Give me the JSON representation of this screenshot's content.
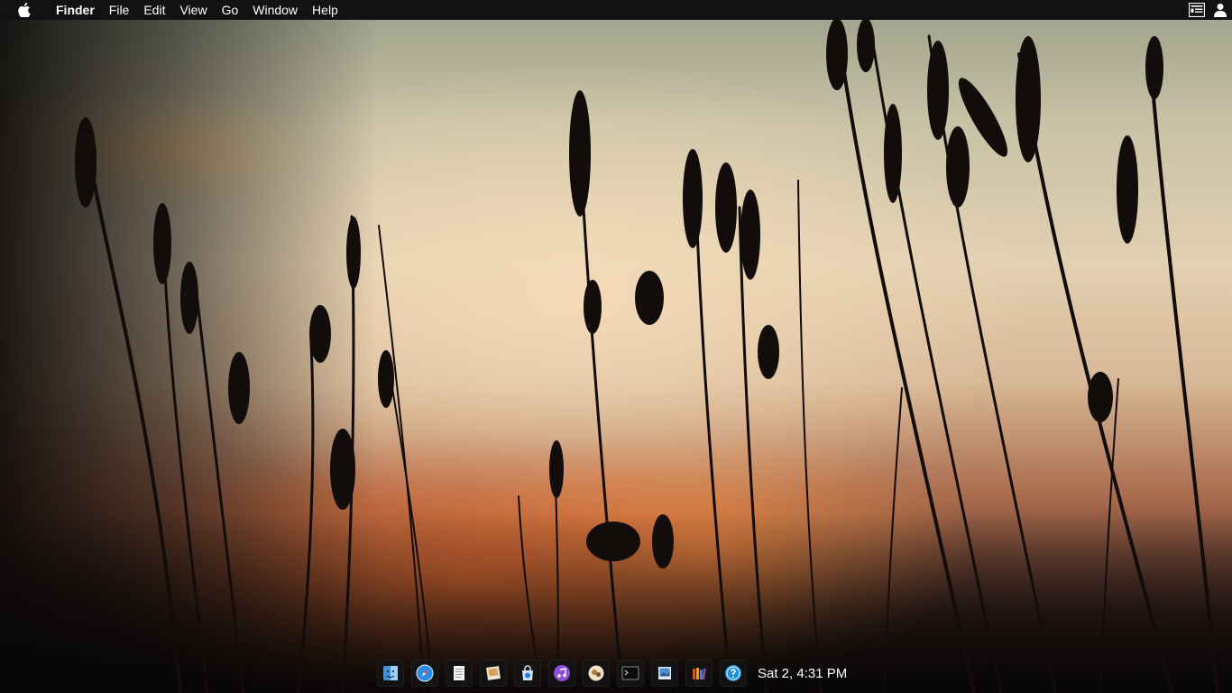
{
  "menubar": {
    "app_name": "Finder",
    "items": [
      "File",
      "Edit",
      "View",
      "Go",
      "Window",
      "Help"
    ],
    "left_icon": "apple-icon",
    "right_icons": [
      "notification-center-icon",
      "user-icon"
    ]
  },
  "dock": {
    "apps": [
      {
        "name": "finder-icon"
      },
      {
        "name": "safari-icon"
      },
      {
        "name": "textedit-icon"
      },
      {
        "name": "preview-icon"
      },
      {
        "name": "app-store-icon"
      },
      {
        "name": "itunes-icon"
      },
      {
        "name": "photos-icon"
      },
      {
        "name": "terminal-icon"
      },
      {
        "name": "image-viewer-icon"
      },
      {
        "name": "books-icon"
      },
      {
        "name": "help-icon"
      }
    ],
    "clock": "Sat 2, 4:31 PM"
  },
  "colors": {
    "menubar_bg": "#121212",
    "text": "#ffffff"
  }
}
